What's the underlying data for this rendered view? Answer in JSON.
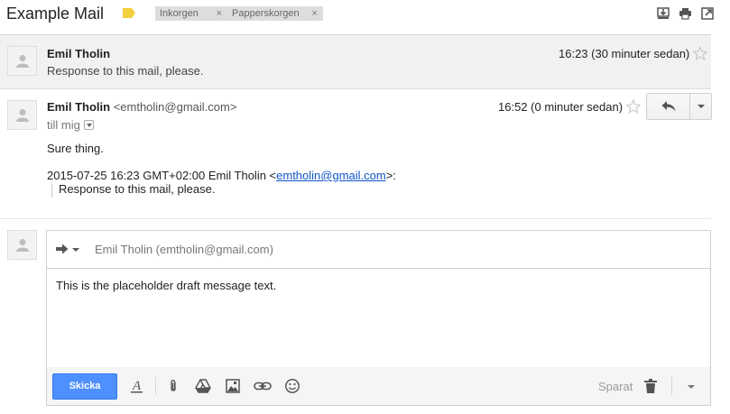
{
  "header": {
    "subject": "Example Mail",
    "labels": [
      {
        "name": "Inkorgen",
        "remove": "×"
      },
      {
        "name": "Papperskorgen",
        "remove": "×"
      }
    ],
    "icons": [
      "download-icon",
      "print-icon",
      "new-window-icon"
    ]
  },
  "messages": [
    {
      "sender": "Emil Tholin",
      "snippet": "Response to this mail, please.",
      "date": "16:23 (30 minuter sedan)",
      "collapsed": true
    },
    {
      "sender": "Emil Tholin",
      "email": "<emtholin@gmail.com>",
      "recipient": "till mig",
      "date": "16:52 (0 minuter sedan)",
      "body": "Sure thing.",
      "quote_header_prefix": "2015-07-25 16:23 GMT+02:00 Emil Tholin <",
      "quote_header_link": "emtholin@gmail.com",
      "quote_header_suffix": ">:",
      "quote_text": "Response to this mail, please."
    }
  ],
  "compose": {
    "to": "Emil Tholin (emtholin@gmail.com)",
    "draft": "This is the placeholder draft message text.",
    "send_label": "Skicka",
    "saved_label": "Sparat"
  },
  "colors": {
    "accent": "#4d90fe",
    "label_marker": "#f4d03f",
    "link": "#1155cc"
  }
}
